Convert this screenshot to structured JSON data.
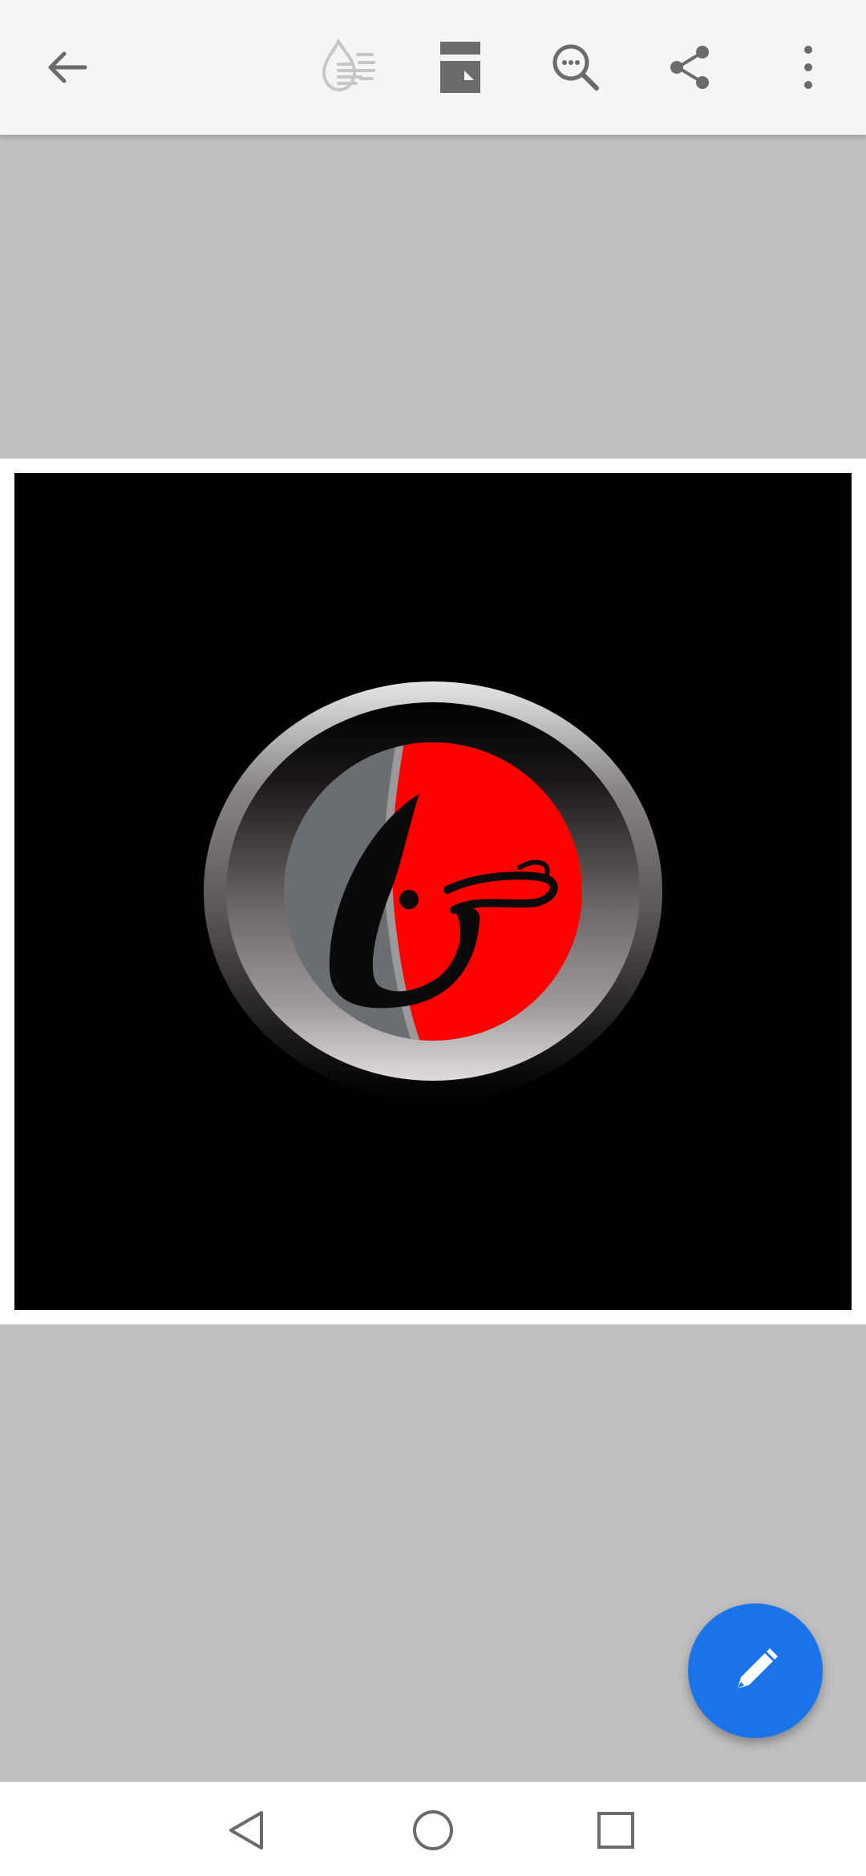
{
  "toolbar": {
    "back": "arrow-left-icon",
    "actions": [
      "ink-drop-icon",
      "page-layout-icon",
      "search-more-icon",
      "share-icon",
      "more-vert-icon"
    ]
  },
  "document": {
    "image": "red-grey-emblem-logo"
  },
  "fab": {
    "icon": "pencil-icon",
    "color": "#1a73e8"
  },
  "navigation": {
    "buttons": [
      "back-triangle-icon",
      "home-circle-icon",
      "recents-square-icon"
    ]
  },
  "colors": {
    "toolbar_bg": "#f5f5f5",
    "canvas_bg": "#bfbfbf",
    "icon": "#6b6b6b",
    "icon_disabled": "#c7c7c7",
    "logo_red": "#ff0000"
  }
}
